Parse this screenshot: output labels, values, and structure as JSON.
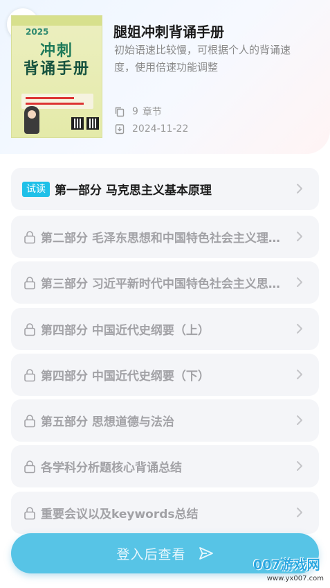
{
  "header": {
    "back_icon": "chevron-left-icon",
    "book_title": "腿姐冲刺背诵手册",
    "book_desc": "初始语速比较慢，可根据个人的背诵速度，使用倍速功能调整",
    "chapters_count": "9",
    "chapters_unit": "章节",
    "date": "2024-11-22"
  },
  "cover": {
    "year": "2025",
    "title_line1": "冲刺",
    "title_line2": "背诵手册"
  },
  "chapters": [
    {
      "label": "第一部分 马克思主义基本原理",
      "badge": "试读",
      "locked": false
    },
    {
      "label": "第二部分 毛泽东思想和中国特色社会主义理论体系概论",
      "locked": true
    },
    {
      "label": "第三部分 习近平新时代中国特色社会主义思想概论",
      "locked": true
    },
    {
      "label": "第四部分 中国近代史纲要（上）",
      "locked": true
    },
    {
      "label": "第四部分 中国近代史纲要（下）",
      "locked": true
    },
    {
      "label": "第五部分 思想道德与法治",
      "locked": true
    },
    {
      "label": "各学科分析题核心背诵总结",
      "locked": true
    },
    {
      "label": "重要会议以及keywords总结",
      "locked": true
    }
  ],
  "login_button": {
    "label": "登入后查看",
    "icon": "send-icon"
  },
  "watermark": {
    "main": "007游戏网",
    "sub": "www.yx007.com"
  },
  "colors": {
    "accent": "#57c4e6",
    "badge": "#1fc0e8",
    "item_bg": "#f4f5f8"
  }
}
